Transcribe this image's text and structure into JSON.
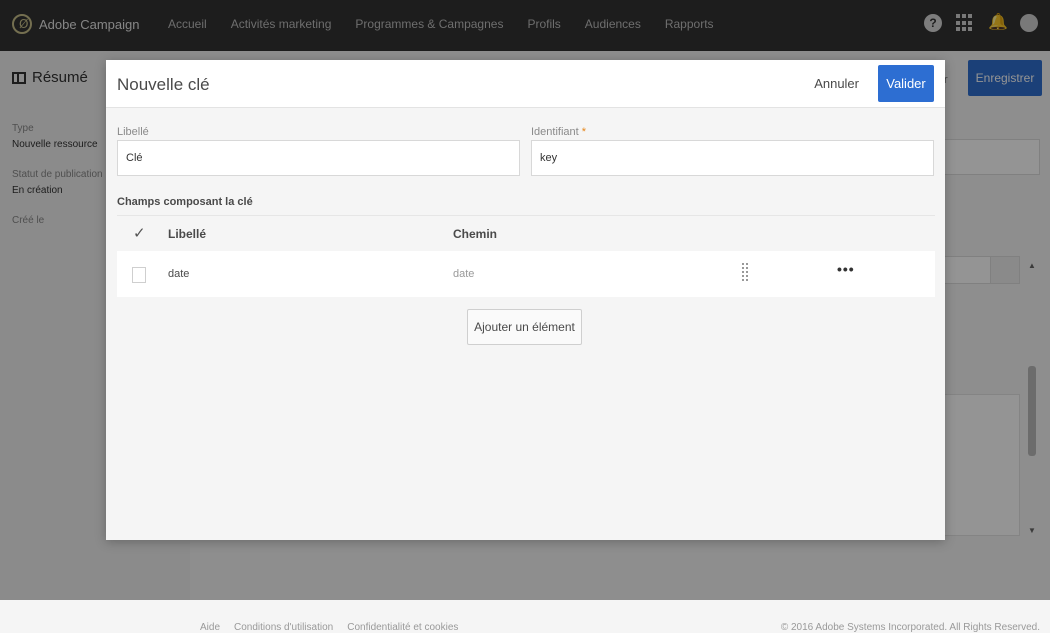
{
  "topbar": {
    "app_name": "Adobe Campaign",
    "logo_glyph": "Ø",
    "nav": [
      "Accueil",
      "Activités marketing",
      "Programmes & Campagnes",
      "Profils",
      "Audiences",
      "Rapports"
    ],
    "help_glyph": "?",
    "icons": [
      "help-icon",
      "apps-grid-icon",
      "bell-icon",
      "avatar-icon"
    ]
  },
  "background": {
    "summary_title": "Résumé",
    "type_label": "Type",
    "type_value": "Nouvelle ressource",
    "status_label": "Statut de publication",
    "status_value": "En création",
    "created_label": "Créé le",
    "save_button": "Enregistrer",
    "partial_text": "r",
    "footer_links": [
      "Aide",
      "Conditions d'utilisation",
      "Confidentialité et cookies"
    ],
    "copyright": "© 2016 Adobe Systems Incorporated. All Rights Reserved."
  },
  "modal": {
    "title": "Nouvelle clé",
    "cancel_label": "Annuler",
    "validate_label": "Valider",
    "label_field": {
      "label": "Libellé",
      "value": "Clé"
    },
    "id_field": {
      "label": "Identifiant",
      "required_mark": "*",
      "value": "key"
    },
    "section_title": "Champs composant la clé",
    "table": {
      "columns": [
        "Libellé",
        "Chemin"
      ],
      "rows": [
        {
          "label": "date",
          "path": "date"
        }
      ]
    },
    "add_button": "Ajouter un élément"
  },
  "colors": {
    "topbar": "#323232",
    "accent": "#2d6ed2",
    "required": "#e68619"
  }
}
